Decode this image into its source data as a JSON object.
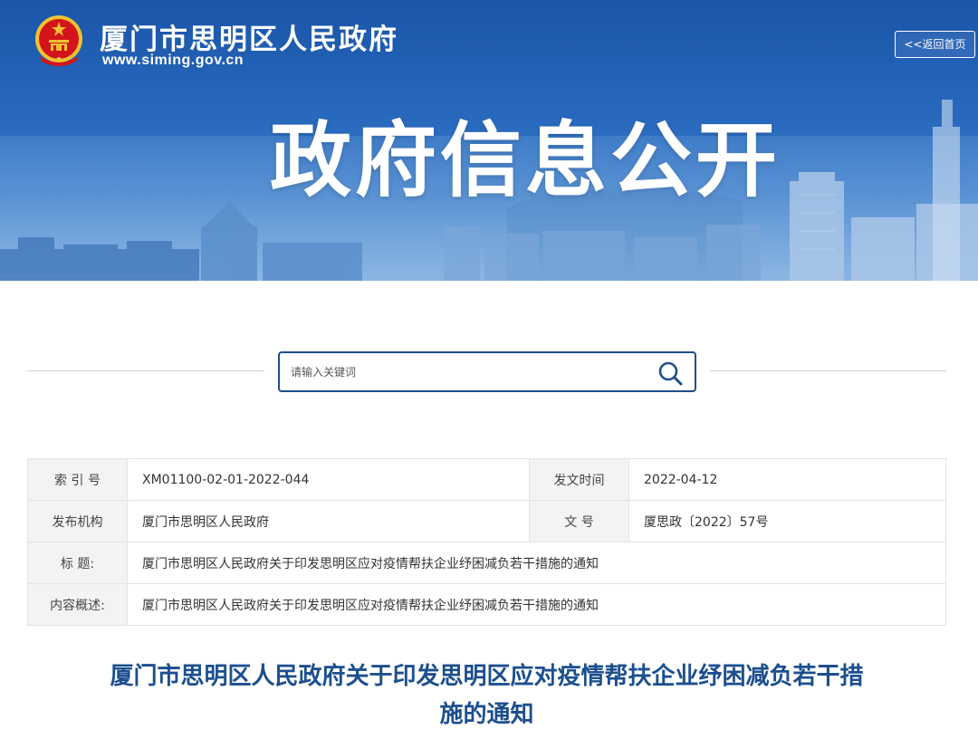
{
  "header": {
    "site_name": "厦门市思明区人民政府",
    "site_url": "www.siming.gov.cn",
    "home_button": "<<返回首页",
    "banner_title": "政府信息公开"
  },
  "search": {
    "placeholder": "请输入关键词"
  },
  "info_table": {
    "index_label": "索 引 号",
    "index_value": "XM01100-02-01-2022-044",
    "date_label": "发文时间",
    "date_value": "2022-04-12",
    "publisher_label": "发布机构",
    "publisher_value": "厦门市思明区人民政府",
    "doc_no_label": "文 号",
    "doc_no_value": "厦思政〔2022〕57号",
    "title_label": "标 题:",
    "title_value": "厦门市思明区人民政府关于印发思明区应对疫情帮扶企业纾困减负若干措施的通知",
    "summary_label": "内容概述:",
    "summary_value": "厦门市思明区人民政府关于印发思明区应对疫情帮扶企业纾困减负若干措施的通知"
  },
  "document": {
    "title_line1": "厦门市思明区人民政府关于印发思明区应对疫情帮扶企业纾困减负若干措",
    "title_line2": "施的通知"
  },
  "colors": {
    "banner_blue": "#1a55a8",
    "title_blue": "#1c4f8e",
    "emblem_red": "#d3141b",
    "emblem_gold": "#f2c230"
  }
}
